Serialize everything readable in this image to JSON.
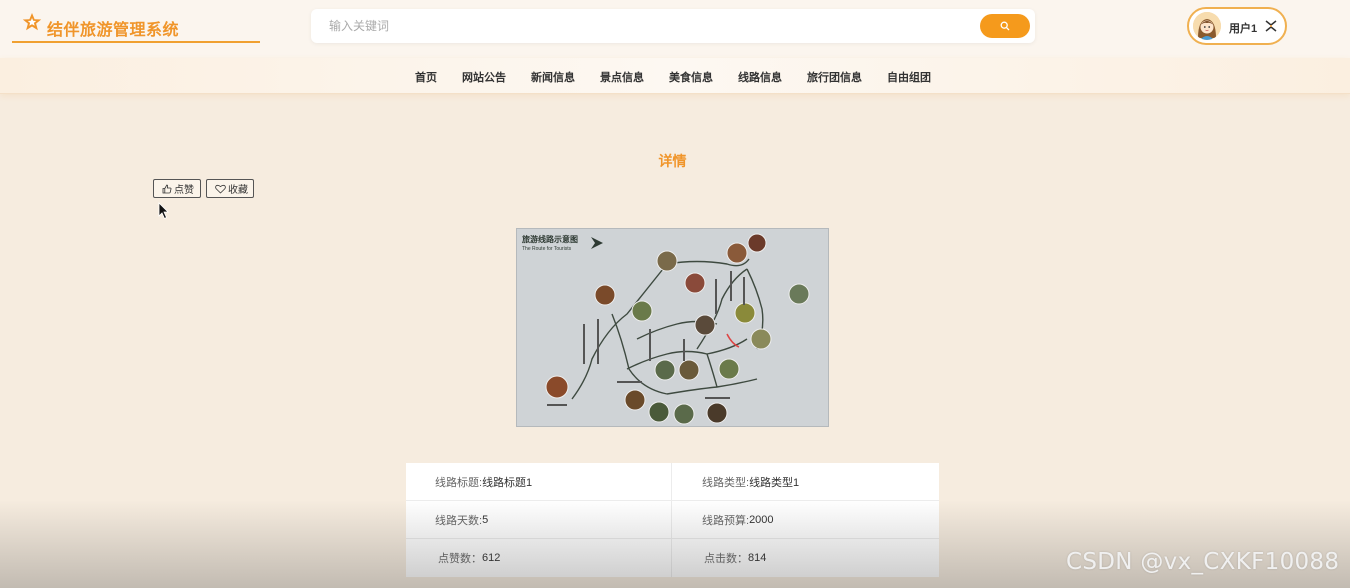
{
  "app": {
    "title": "结伴旅游管理系统"
  },
  "search": {
    "placeholder": "输入关键词"
  },
  "user": {
    "name": "用户1"
  },
  "nav": {
    "items": [
      "首页",
      "网站公告",
      "新闻信息",
      "景点信息",
      "美食信息",
      "线路信息",
      "旅行团信息",
      "自由组团"
    ]
  },
  "page": {
    "title": "详情",
    "like_label": "点赞",
    "favorite_label": "收藏"
  },
  "image": {
    "title_cn": "旅游线路示意图",
    "title_en": "The Route for Tourists"
  },
  "details": {
    "route_title_label": "线路标题:",
    "route_title_value": "线路标题1",
    "route_type_label": "线路类型:",
    "route_type_value": "线路类型1",
    "route_days_label": "线路天数:",
    "route_days_value": "5",
    "route_budget_label": "线路预算:",
    "route_budget_value": "2000",
    "likes_label": "点赞数：",
    "likes_value": "612",
    "clicks_label": "点击数：",
    "clicks_value": "814"
  },
  "watermark": "CSDN @vx_CXKF10088",
  "colors": {
    "accent": "#f0952a",
    "button": "#f59a1c",
    "background": "#f6ecdf"
  },
  "icons": {
    "logo": "star-icon",
    "search": "search-icon",
    "toggle": "collapse-icon",
    "like": "thumbs-up-icon",
    "favorite": "heart-icon"
  }
}
